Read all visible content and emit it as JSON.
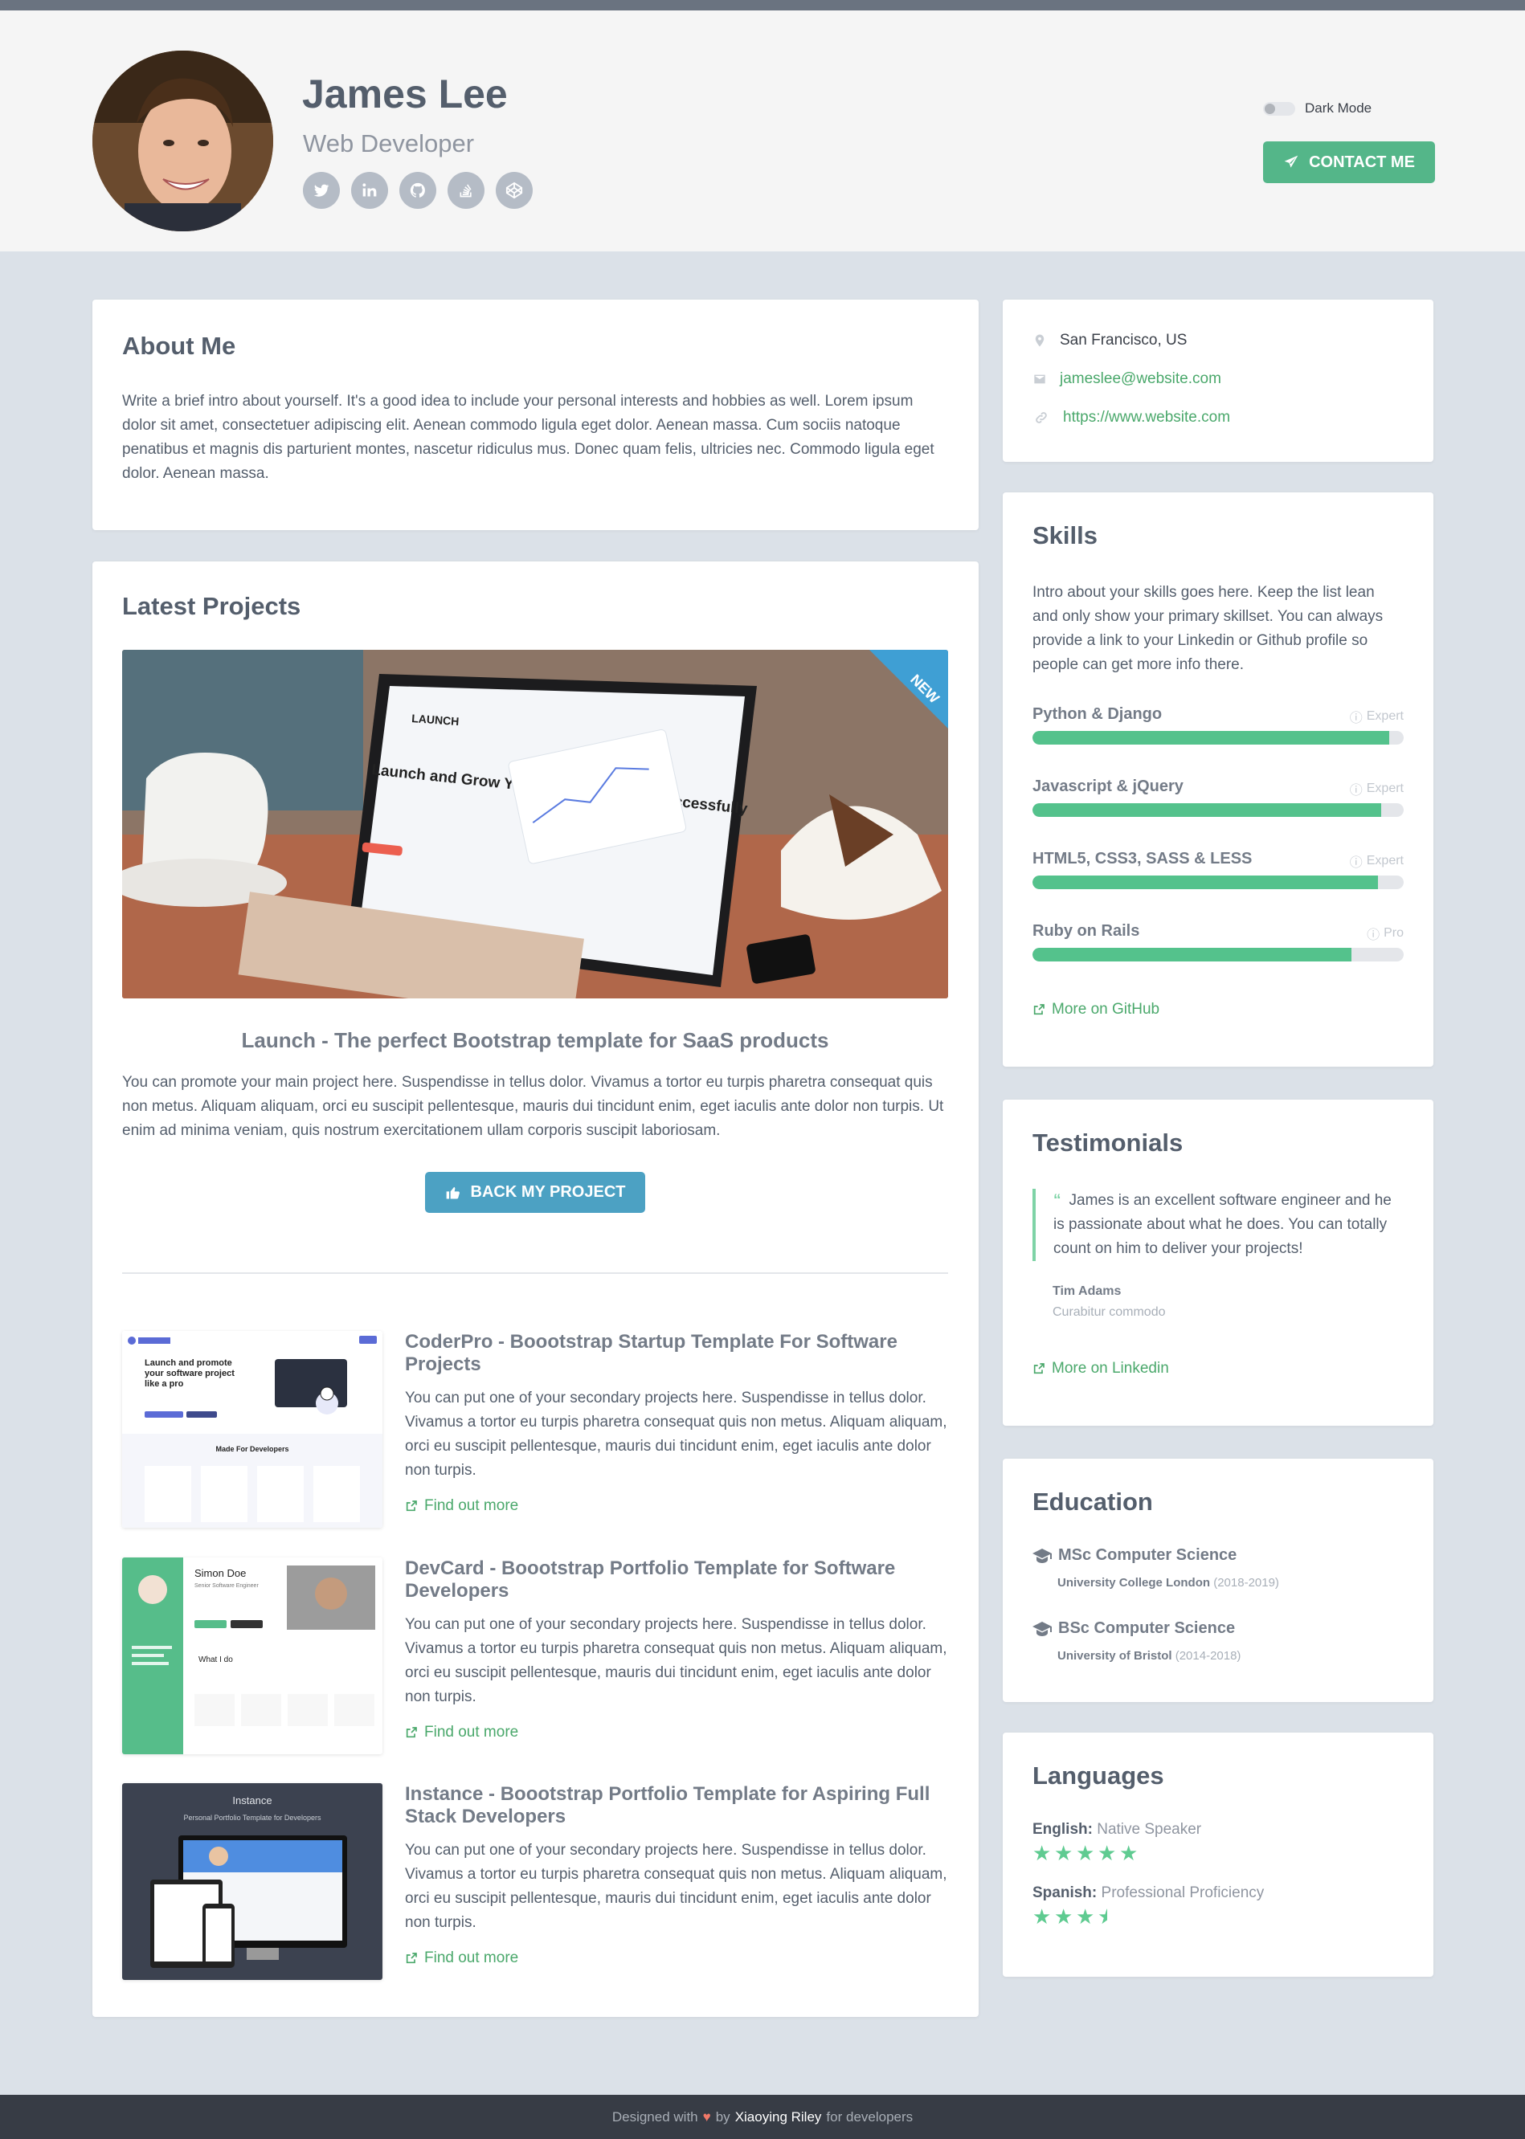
{
  "profile": {
    "name": "James Lee",
    "title": "Web Developer",
    "social_icons": [
      "twitter-icon",
      "linkedin-icon",
      "github-icon",
      "stack-overflow-icon",
      "codepen-icon"
    ]
  },
  "header": {
    "dark_mode_label": "Dark Mode",
    "contact_label": "CONTACT ME"
  },
  "about": {
    "heading": "About Me",
    "text": "Write a brief intro about yourself. It's a good idea to include your personal interests and hobbies as well. Lorem ipsum dolor sit amet, consectetuer adipiscing elit. Aenean commodo ligula eget dolor. Aenean massa. Cum sociis natoque penatibus et magnis dis parturient montes, nascetur ridiculus mus. Donec quam felis, ultricies nec. Commodo ligula eget dolor. Aenean massa."
  },
  "projects": {
    "heading": "Latest Projects",
    "featured": {
      "ribbon": "NEW",
      "title": "Launch - The perfect Bootstrap template for SaaS products",
      "text": "You can promote your main project here. Suspendisse in tellus dolor. Vivamus a tortor eu turpis pharetra consequat quis non metus. Aliquam aliquam, orci eu suscipit pellentesque, mauris dui tincidunt enim, eget iaculis ante dolor non turpis. Ut enim ad minima veniam, quis nostrum exercitationem ullam corporis suscipit laboriosam.",
      "button": "BACK MY PROJECT",
      "screen_brand": "LAUNCH",
      "screen_headline": "Launch and Grow Your SaaS Business Successfully"
    },
    "secondary": [
      {
        "title": "CoderPro - Boootstrap Startup Template For Software Projects",
        "text": "You can put one of your secondary projects here. Suspendisse in tellus dolor. Vivamus a tortor eu turpis pharetra consequat quis non metus. Aliquam aliquam, orci eu suscipit pellentesque, mauris dui tincidunt enim, eget iaculis ante dolor non turpis.",
        "link": "Find out more",
        "thumb_heading": "Launch and promote your software project like a pro",
        "thumb_sub": "Made For Developers"
      },
      {
        "title": "DevCard - Boootstrap Portfolio Template for Software Developers",
        "text": "You can put one of your secondary projects here. Suspendisse in tellus dolor. Vivamus a tortor eu turpis pharetra consequat quis non metus. Aliquam aliquam, orci eu suscipit pellentesque, mauris dui tincidunt enim, eget iaculis ante dolor non turpis.",
        "link": "Find out more",
        "thumb_name": "Simon Doe",
        "thumb_role": "Senior Software Engineer",
        "thumb_section": "What I do"
      },
      {
        "title": "Instance - Boootstrap Portfolio Template for Aspiring Full Stack Developers",
        "text": "You can put one of your secondary projects here. Suspendisse in tellus dolor. Vivamus a tortor eu turpis pharetra consequat quis non metus. Aliquam aliquam, orci eu suscipit pellentesque, mauris dui tincidunt enim, eget iaculis ante dolor non turpis.",
        "link": "Find out more",
        "thumb_heading": "Instance",
        "thumb_sub": "Personal Portfolio Template for Developers"
      }
    ]
  },
  "info": {
    "location": "San Francisco, US",
    "email": "jameslee@website.com",
    "website": "https://www.website.com"
  },
  "skills": {
    "heading": "Skills",
    "intro": "Intro about your skills goes here. Keep the list lean and only show your primary skillset. You can always provide a link to your Linkedin or Github profile so people can get more info there.",
    "items": [
      {
        "name": "Python & Django",
        "level": "Expert",
        "percent": 96
      },
      {
        "name": "Javascript & jQuery",
        "level": "Expert",
        "percent": 94
      },
      {
        "name": "HTML5, CSS3, SASS & LESS",
        "level": "Expert",
        "percent": 93
      },
      {
        "name": "Ruby on Rails",
        "level": "Pro",
        "percent": 86
      }
    ],
    "more_link": "More on GitHub"
  },
  "testimonials": {
    "heading": "Testimonials",
    "quote": "James is an excellent software engineer and he is passionate about what he does. You can totally count on him to deliver your projects!",
    "author": "Tim Adams",
    "author_role": "Curabitur commodo",
    "more_link": "More on Linkedin"
  },
  "education": {
    "heading": "Education",
    "items": [
      {
        "degree": "MSc Computer Science",
        "school": "University College London",
        "years": "(2018-2019)"
      },
      {
        "degree": "BSc Computer Science",
        "school": "University of Bristol",
        "years": "(2014-2018)"
      }
    ]
  },
  "languages": {
    "heading": "Languages",
    "items": [
      {
        "name": "English:",
        "level": "Native Speaker",
        "stars": 5
      },
      {
        "name": "Spanish:",
        "level": "Professional Proficiency",
        "stars": 3.5
      }
    ]
  },
  "footer": {
    "prefix": "Designed with",
    "by": "by",
    "author": "Xiaoying Riley",
    "suffix": "for developers"
  },
  "colors": {
    "accent_green": "#54b689",
    "accent_blue": "#4ca1c3",
    "bar_green": "#54c28c",
    "page_bg": "#dbe1e8",
    "footer_bg": "#373c45"
  }
}
